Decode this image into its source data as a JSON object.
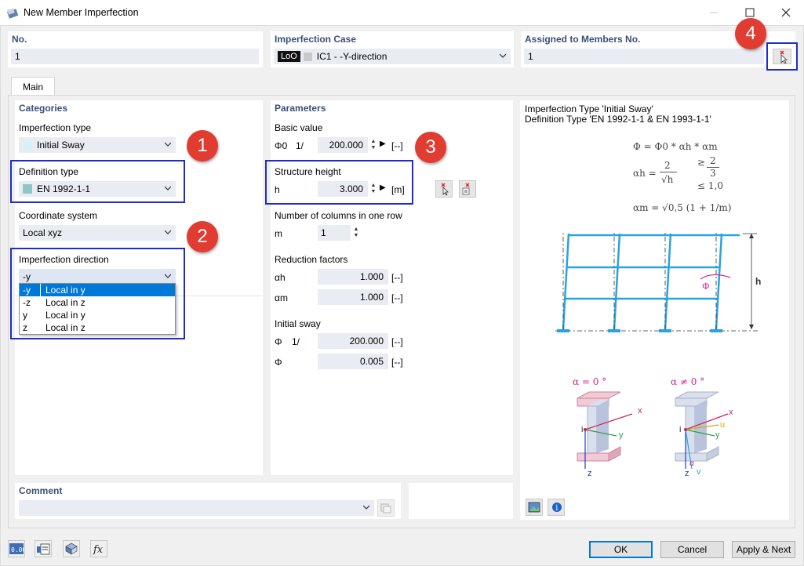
{
  "window": {
    "title": "New Member Imperfection",
    "minimize": "—",
    "maximize": "☐",
    "close": "✕"
  },
  "header": {
    "no": {
      "label": "No.",
      "value": "1"
    },
    "imperfection_case": {
      "label": "Imperfection Case",
      "tag": "LoO",
      "value": "IC1 - -Y-direction"
    },
    "assigned": {
      "label": "Assigned to Members No.",
      "value": "1"
    }
  },
  "tabs": [
    {
      "label": "Main"
    }
  ],
  "categories": {
    "title": "Categories",
    "imperfection_type": {
      "label": "Imperfection type",
      "value": "Initial Sway",
      "swatch": "#d8f0f8"
    },
    "definition_type": {
      "label": "Definition type",
      "value": "EN 1992-1-1",
      "swatch": "#8fc7c7"
    },
    "coordinate_system": {
      "label": "Coordinate system",
      "value": "Local xyz"
    },
    "imperfection_direction": {
      "label": "Imperfection direction",
      "value": "-y",
      "options": [
        {
          "code": "-y",
          "text": "Local in y",
          "selected": true
        },
        {
          "code": "-z",
          "text": "Local in z",
          "selected": false
        },
        {
          "code": "y",
          "text": "Local in y",
          "selected": false
        },
        {
          "code": "z",
          "text": "Local in z",
          "selected": false
        }
      ]
    }
  },
  "parameters": {
    "title": "Parameters",
    "basic_value": {
      "label": "Basic value",
      "symbol": "Φ0",
      "prefix": "1/",
      "value": "200.000",
      "unit": "[--]"
    },
    "structure_height": {
      "label": "Structure height",
      "symbol": "h",
      "value": "3.000",
      "unit": "[m]"
    },
    "columns": {
      "label": "Number of columns in one row",
      "symbol": "m",
      "value": "1"
    },
    "reduction": {
      "label": "Reduction factors",
      "alpha_h": {
        "symbol": "αh",
        "value": "1.000",
        "unit": "[--]"
      },
      "alpha_m": {
        "symbol": "αm",
        "value": "1.000",
        "unit": "[--]"
      }
    },
    "initial_sway": {
      "label": "Initial sway",
      "phi_inv": {
        "symbol": "Φ",
        "prefix": "1/",
        "value": "200.000",
        "unit": "[--]"
      },
      "phi": {
        "symbol": "Φ",
        "value": "0.005",
        "unit": "[--]"
      }
    }
  },
  "info": {
    "line1": "Imperfection Type 'Initial Sway'",
    "line2": "Definition Type 'EN 1992-1-1 & EN 1993-1-1'",
    "formula1": "Φ = Φ0 * αh * αm",
    "alpha_h_lhs": "αh =",
    "alpha_h_num": "2",
    "alpha_h_den": "√h",
    "alpha_h_ge": "≥",
    "alpha_h_ge_num": "2",
    "alpha_h_ge_den": "3",
    "alpha_h_le": "≤ 1,0",
    "alpha_m": "αm = √0,5 (1 + 1/m)",
    "frame_h": "h",
    "frame_phi": "Φ",
    "sec1_title": "α = 0 °",
    "sec2_title": "α ≠ 0 °",
    "axis_x": "x",
    "axis_y": "y",
    "axis_z": "z",
    "axis_i": "i",
    "axis_u": "u",
    "axis_v": "v",
    "axis_alpha": "α"
  },
  "comment": {
    "label": "Comment",
    "value": ""
  },
  "badges": [
    "1",
    "2",
    "3",
    "4"
  ],
  "buttons": {
    "ok": "OK",
    "cancel": "Cancel",
    "apply_next": "Apply & Next"
  },
  "bottom_icons": [
    "units-icon",
    "model-data-icon",
    "view-icon",
    "formula-icon"
  ],
  "colors": {
    "accent": "#1f2ccc",
    "badge": "#e03c31",
    "header_text": "#3b4f79",
    "field_bg": "#e9ecf2",
    "selection": "#0078d7"
  }
}
